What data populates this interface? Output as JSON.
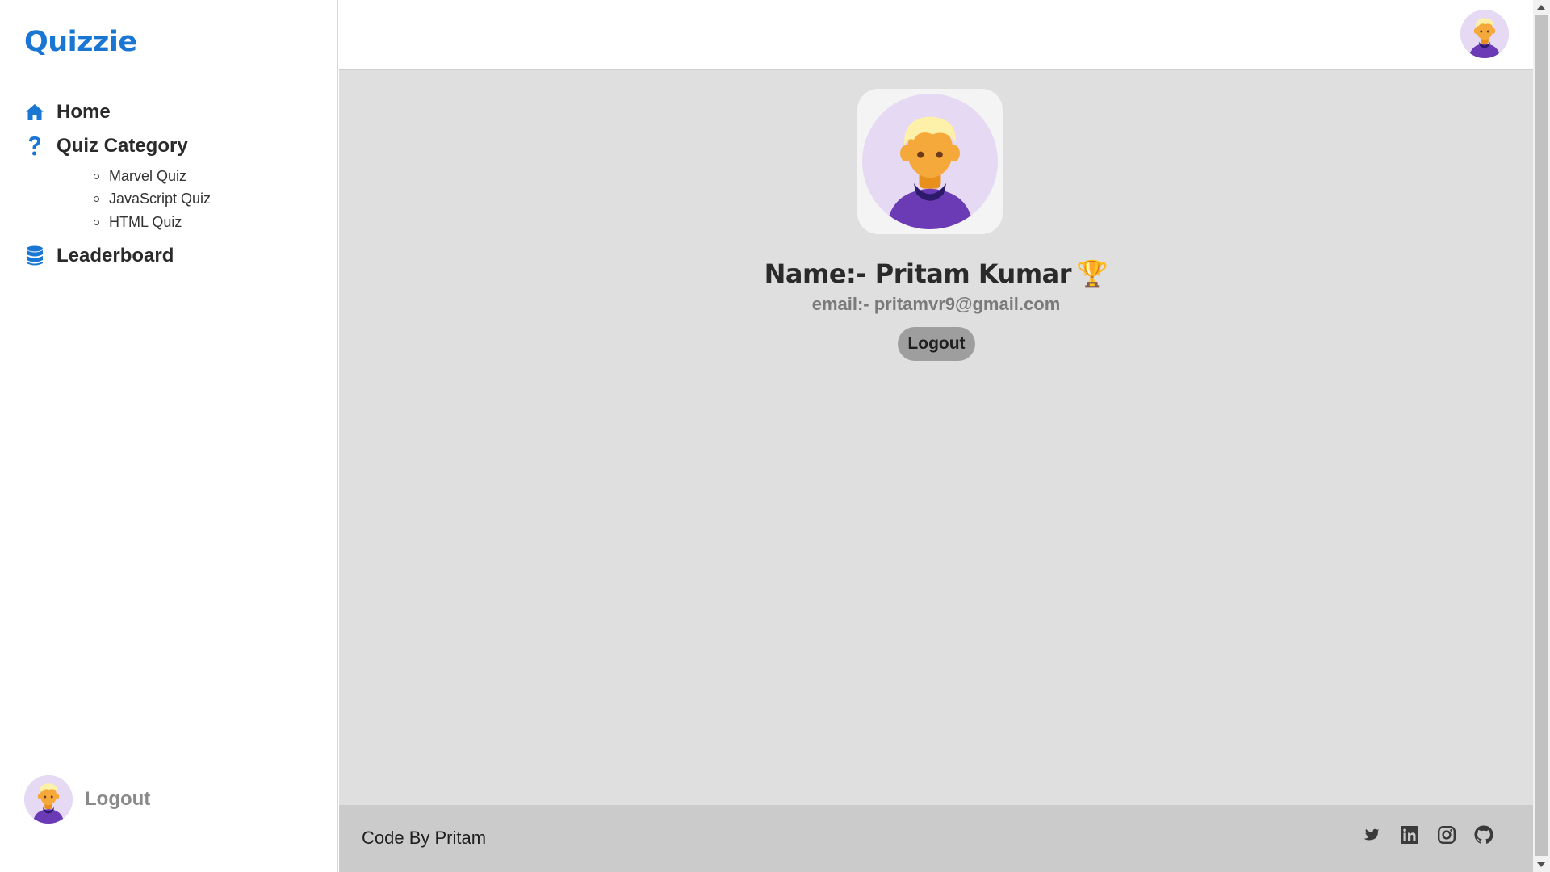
{
  "sidebar": {
    "brand": "Quizzie",
    "items": [
      {
        "label": "Home",
        "icon": "home-icon"
      },
      {
        "label": "Quiz Category",
        "icon": "question-icon"
      },
      {
        "label": "Leaderboard",
        "icon": "database-icon"
      }
    ],
    "sub_items": [
      "Marvel Quiz",
      "JavaScript Quiz",
      "HTML Quiz"
    ],
    "footer_label": "Logout"
  },
  "profile": {
    "name": "Name:- Pritam Kumar",
    "trophy": "🏆",
    "email": "email:- pritamvr9@gmail.com",
    "logout_label": "Logout"
  },
  "footer": {
    "credit": "Code By Pritam",
    "socials": [
      "twitter-icon",
      "linkedin-icon",
      "instagram-icon",
      "github-icon"
    ]
  },
  "colors": {
    "accent": "#1976d2",
    "main_bg": "#e0dfe0",
    "footer_bg": "#cbcbcb",
    "avatar_bg": "#e6d9f3",
    "avatar_shirt": "#6a3bb5",
    "avatar_skin": "#f6a93b",
    "avatar_hair": "#fdf0a8"
  }
}
